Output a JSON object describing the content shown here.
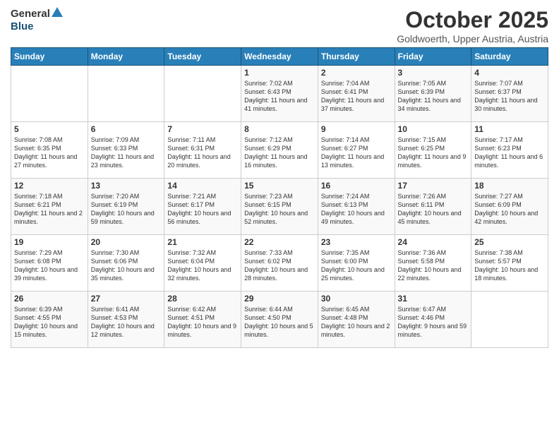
{
  "header": {
    "logo_general": "General",
    "logo_blue": "Blue",
    "month_title": "October 2025",
    "location": "Goldwoerth, Upper Austria, Austria"
  },
  "weekdays": [
    "Sunday",
    "Monday",
    "Tuesday",
    "Wednesday",
    "Thursday",
    "Friday",
    "Saturday"
  ],
  "weeks": [
    [
      {
        "day": "",
        "content": ""
      },
      {
        "day": "",
        "content": ""
      },
      {
        "day": "",
        "content": ""
      },
      {
        "day": "1",
        "content": "Sunrise: 7:02 AM\nSunset: 6:43 PM\nDaylight: 11 hours\nand 41 minutes."
      },
      {
        "day": "2",
        "content": "Sunrise: 7:04 AM\nSunset: 6:41 PM\nDaylight: 11 hours\nand 37 minutes."
      },
      {
        "day": "3",
        "content": "Sunrise: 7:05 AM\nSunset: 6:39 PM\nDaylight: 11 hours\nand 34 minutes."
      },
      {
        "day": "4",
        "content": "Sunrise: 7:07 AM\nSunset: 6:37 PM\nDaylight: 11 hours\nand 30 minutes."
      }
    ],
    [
      {
        "day": "5",
        "content": "Sunrise: 7:08 AM\nSunset: 6:35 PM\nDaylight: 11 hours\nand 27 minutes."
      },
      {
        "day": "6",
        "content": "Sunrise: 7:09 AM\nSunset: 6:33 PM\nDaylight: 11 hours\nand 23 minutes."
      },
      {
        "day": "7",
        "content": "Sunrise: 7:11 AM\nSunset: 6:31 PM\nDaylight: 11 hours\nand 20 minutes."
      },
      {
        "day": "8",
        "content": "Sunrise: 7:12 AM\nSunset: 6:29 PM\nDaylight: 11 hours\nand 16 minutes."
      },
      {
        "day": "9",
        "content": "Sunrise: 7:14 AM\nSunset: 6:27 PM\nDaylight: 11 hours\nand 13 minutes."
      },
      {
        "day": "10",
        "content": "Sunrise: 7:15 AM\nSunset: 6:25 PM\nDaylight: 11 hours\nand 9 minutes."
      },
      {
        "day": "11",
        "content": "Sunrise: 7:17 AM\nSunset: 6:23 PM\nDaylight: 11 hours\nand 6 minutes."
      }
    ],
    [
      {
        "day": "12",
        "content": "Sunrise: 7:18 AM\nSunset: 6:21 PM\nDaylight: 11 hours\nand 2 minutes."
      },
      {
        "day": "13",
        "content": "Sunrise: 7:20 AM\nSunset: 6:19 PM\nDaylight: 10 hours\nand 59 minutes."
      },
      {
        "day": "14",
        "content": "Sunrise: 7:21 AM\nSunset: 6:17 PM\nDaylight: 10 hours\nand 56 minutes."
      },
      {
        "day": "15",
        "content": "Sunrise: 7:23 AM\nSunset: 6:15 PM\nDaylight: 10 hours\nand 52 minutes."
      },
      {
        "day": "16",
        "content": "Sunrise: 7:24 AM\nSunset: 6:13 PM\nDaylight: 10 hours\nand 49 minutes."
      },
      {
        "day": "17",
        "content": "Sunrise: 7:26 AM\nSunset: 6:11 PM\nDaylight: 10 hours\nand 45 minutes."
      },
      {
        "day": "18",
        "content": "Sunrise: 7:27 AM\nSunset: 6:09 PM\nDaylight: 10 hours\nand 42 minutes."
      }
    ],
    [
      {
        "day": "19",
        "content": "Sunrise: 7:29 AM\nSunset: 6:08 PM\nDaylight: 10 hours\nand 39 minutes."
      },
      {
        "day": "20",
        "content": "Sunrise: 7:30 AM\nSunset: 6:06 PM\nDaylight: 10 hours\nand 35 minutes."
      },
      {
        "day": "21",
        "content": "Sunrise: 7:32 AM\nSunset: 6:04 PM\nDaylight: 10 hours\nand 32 minutes."
      },
      {
        "day": "22",
        "content": "Sunrise: 7:33 AM\nSunset: 6:02 PM\nDaylight: 10 hours\nand 28 minutes."
      },
      {
        "day": "23",
        "content": "Sunrise: 7:35 AM\nSunset: 6:00 PM\nDaylight: 10 hours\nand 25 minutes."
      },
      {
        "day": "24",
        "content": "Sunrise: 7:36 AM\nSunset: 5:58 PM\nDaylight: 10 hours\nand 22 minutes."
      },
      {
        "day": "25",
        "content": "Sunrise: 7:38 AM\nSunset: 5:57 PM\nDaylight: 10 hours\nand 18 minutes."
      }
    ],
    [
      {
        "day": "26",
        "content": "Sunrise: 6:39 AM\nSunset: 4:55 PM\nDaylight: 10 hours\nand 15 minutes."
      },
      {
        "day": "27",
        "content": "Sunrise: 6:41 AM\nSunset: 4:53 PM\nDaylight: 10 hours\nand 12 minutes."
      },
      {
        "day": "28",
        "content": "Sunrise: 6:42 AM\nSunset: 4:51 PM\nDaylight: 10 hours\nand 9 minutes."
      },
      {
        "day": "29",
        "content": "Sunrise: 6:44 AM\nSunset: 4:50 PM\nDaylight: 10 hours\nand 5 minutes."
      },
      {
        "day": "30",
        "content": "Sunrise: 6:45 AM\nSunset: 4:48 PM\nDaylight: 10 hours\nand 2 minutes."
      },
      {
        "day": "31",
        "content": "Sunrise: 6:47 AM\nSunset: 4:46 PM\nDaylight: 9 hours\nand 59 minutes."
      },
      {
        "day": "",
        "content": ""
      }
    ]
  ]
}
